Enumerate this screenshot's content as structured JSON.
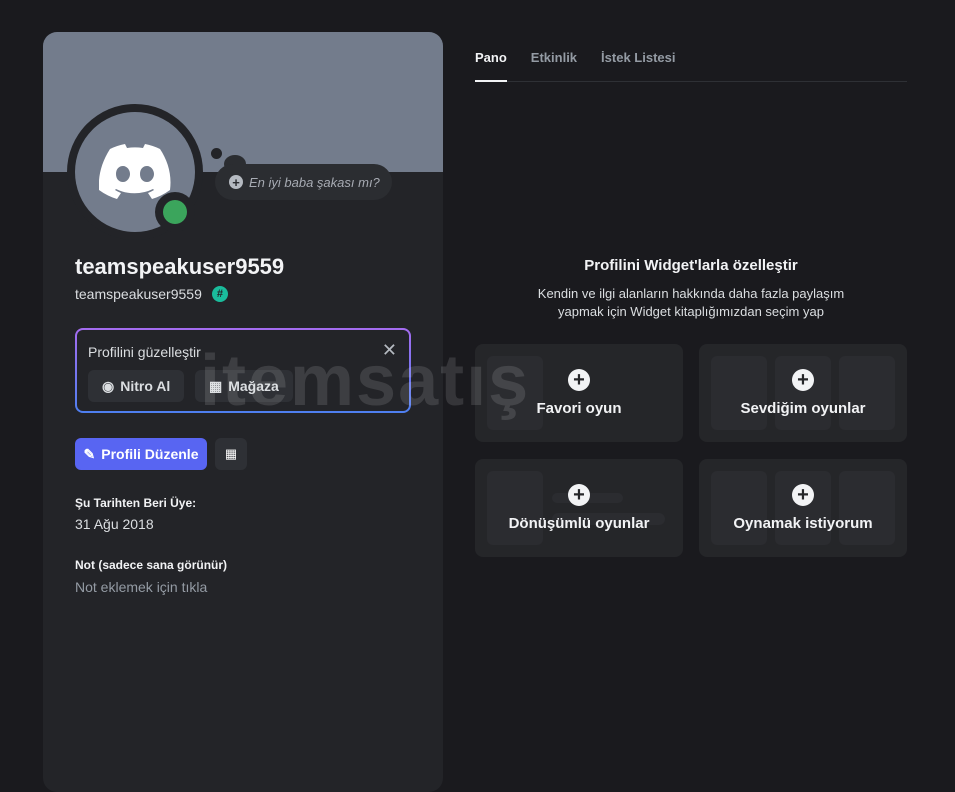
{
  "profile": {
    "custom_status_placeholder": "En iyi baba şakası mı?",
    "display_name": "teamspeakuser9559",
    "username": "teamspeakuser9559",
    "badge": "#",
    "promo": {
      "title": "Profilini güzelleştir",
      "nitro_label": "Nitro Al",
      "shop_label": "Mağaza"
    },
    "edit_label": "Profili Düzenle",
    "member_since_label": "Şu Tarihten Beri Üye:",
    "member_since": "31 Ağu 2018",
    "note_label": "Not (sadece sana görünür)",
    "note_placeholder": "Not eklemek için tıkla"
  },
  "tabs": [
    {
      "label": "Pano"
    },
    {
      "label": "Etkinlik"
    },
    {
      "label": "İstek Listesi"
    }
  ],
  "widgets": {
    "title": "Profilini Widget'larla özelleştir",
    "description": "Kendin ve ilgi alanların hakkında daha fazla paylaşım yapmak için Widget kitaplığımızdan seçim yap",
    "cards": [
      {
        "label": "Favori oyun"
      },
      {
        "label": "Sevdiğim oyunlar"
      },
      {
        "label": "Dönüşümlü oyunlar"
      },
      {
        "label": "Oynamak istiyorum"
      }
    ]
  },
  "watermark": "itemsatış",
  "colors": {
    "accent": "#5865f2",
    "status_online": "#3ba55c",
    "banner": "#737c8c"
  }
}
